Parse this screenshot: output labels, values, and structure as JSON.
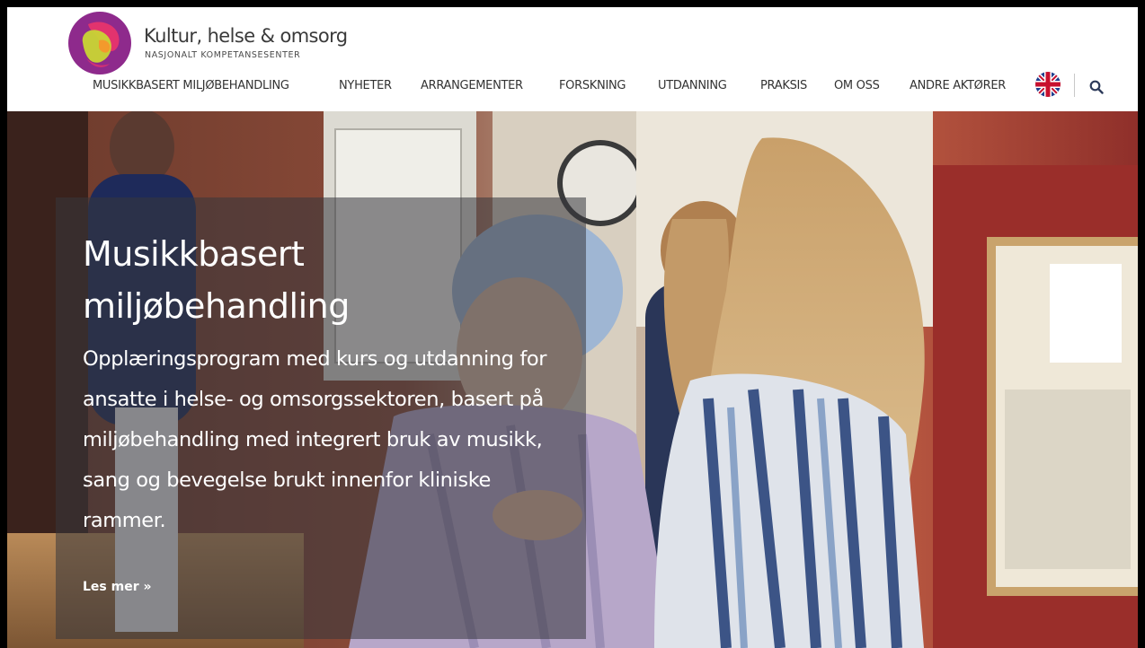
{
  "brand": {
    "name": "Kultur, helse & omsorg",
    "subtitle": "NASJONALT KOMPETANSESENTER",
    "logo_icon": "overlapping-circles-logo",
    "logo_colors": [
      "#8e2a8c",
      "#e2336e",
      "#c9d534",
      "#f39a2c"
    ]
  },
  "nav": {
    "items": [
      {
        "label": "MUSIKKBASERT MILJØBEHANDLING"
      },
      {
        "label": "NYHETER"
      },
      {
        "label": "ARRANGEMENTER"
      },
      {
        "label": "FORSKNING"
      },
      {
        "label": "UTDANNING"
      },
      {
        "label": "PRAKSIS"
      },
      {
        "label": "OM OSS"
      },
      {
        "label": "ANDRE AKTØRER"
      }
    ],
    "language_icon": "uk-flag-icon",
    "search_icon": "search-icon"
  },
  "hero": {
    "title": "Musikkbasert miljøbehandling",
    "text": "Opplæringsprogram med kurs og utdanning for ansatte i helse- og omsorgssektoren, basert på miljøbehandling med integrert bruk av musikk, sang og bevegelse brukt innenfor kliniske rammer.",
    "link": "Les mer »",
    "overlay_color": "#37373c"
  }
}
